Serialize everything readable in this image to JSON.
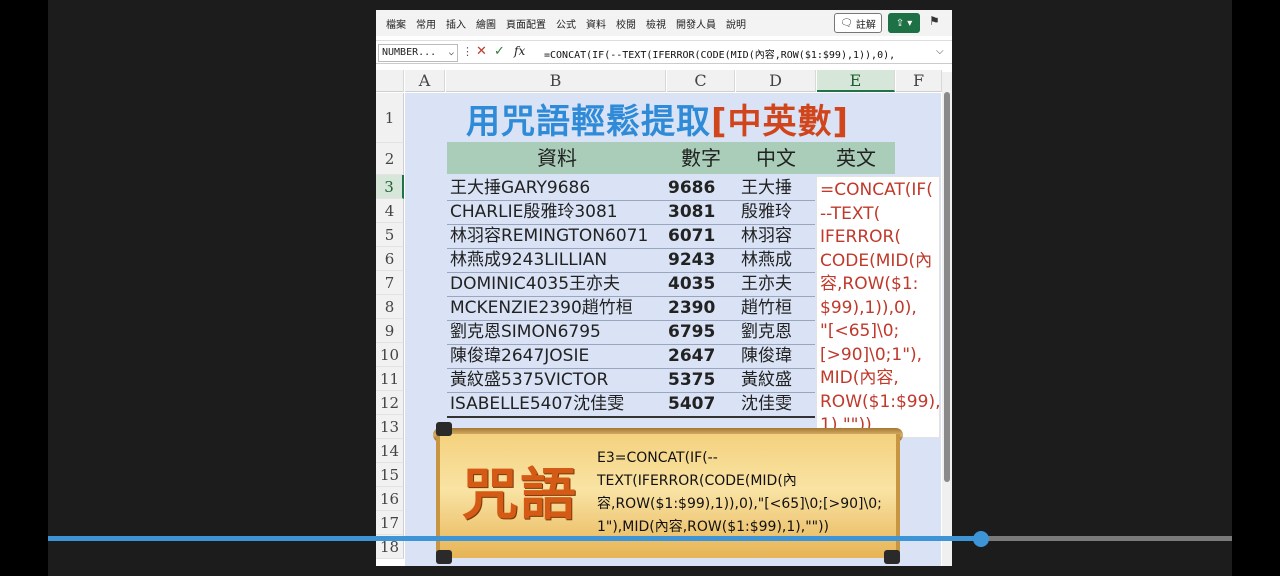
{
  "ribbon": {
    "tabs": [
      "檔案",
      "常用",
      "插入",
      "繪圖",
      "頁面配置",
      "公式",
      "資料",
      "校閱",
      "檢視",
      "開發人員",
      "說明"
    ],
    "comment_label": "註解",
    "share_icon": "share-icon"
  },
  "formula_bar": {
    "name_box": "NUMBER...",
    "fx_label": "fx",
    "formula": "=CONCAT(IF(--TEXT(IFERROR(CODE(MID(內容,ROW($1:$99),1)),0),"
  },
  "grid": {
    "columns": [
      "A",
      "B",
      "C",
      "D",
      "E",
      "F"
    ],
    "rows": [
      "1",
      "2",
      "3",
      "4",
      "5",
      "6",
      "7",
      "8",
      "9",
      "10",
      "11",
      "12",
      "13",
      "14",
      "15",
      "16",
      "17",
      "18"
    ]
  },
  "sheet": {
    "title_main": "用咒語輕鬆提取",
    "title_accent": "[中英數]",
    "headers": [
      "資料",
      "數字",
      "中文",
      "英文"
    ],
    "rows": [
      {
        "data": "王大捶GARY9686",
        "num": "9686",
        "zh": "王大捶"
      },
      {
        "data": "CHARLIE殷雅玲3081",
        "num": "3081",
        "zh": "殷雅玲"
      },
      {
        "data": "林羽容REMINGTON6071",
        "num": "6071",
        "zh": "林羽容"
      },
      {
        "data": "林燕成9243LILLIAN",
        "num": "9243",
        "zh": "林燕成"
      },
      {
        "data": "DOMINIC4035王亦夫",
        "num": "4035",
        "zh": "王亦夫"
      },
      {
        "data": "MCKENZIE2390趙竹桓",
        "num": "2390",
        "zh": "趙竹桓"
      },
      {
        "data": "劉克恩SIMON6795",
        "num": "6795",
        "zh": "劉克恩"
      },
      {
        "data": "陳俊瑋2647JOSIE",
        "num": "2647",
        "zh": "陳俊瑋"
      },
      {
        "data": "黃紋盛5375VICTOR",
        "num": "5375",
        "zh": "黃紋盛"
      },
      {
        "data": "ISABELLE5407沈佳雯",
        "num": "5407",
        "zh": "沈佳雯"
      }
    ]
  },
  "popup": {
    "lines": [
      "=CONCAT(IF(",
      "--TEXT(",
      "IFERROR(",
      "CODE(MID(內",
      "容,ROW($1:",
      "$99),1)),0),",
      "\"[<65]\\0;",
      "[>90]\\0;1\"),",
      "MID(內容,",
      "ROW($1:$99),",
      "1),\"\"))"
    ]
  },
  "spell": {
    "word": "咒語",
    "lines": [
      "E3=CONCAT(IF(--",
      "TEXT(IFERROR(CODE(MID(內",
      "容,ROW($1:$99),1)),0),\"[<65]\\0;[>90]\\0;",
      "1\"),MID(內容,ROW($1:$99),1),\"\"))"
    ]
  },
  "video": {
    "progress": 0.788
  }
}
